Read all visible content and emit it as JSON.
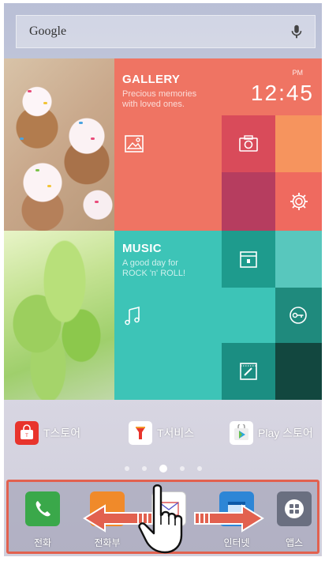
{
  "search": {
    "label": "Google",
    "mic_icon": "mic-icon"
  },
  "tiles": {
    "gallery": {
      "title": "GALLERY",
      "subtitle_line1": "Precious memories",
      "subtitle_line2": "with loved ones.",
      "icon": "image-icon"
    },
    "clock": {
      "ampm": "PM",
      "time": "12:45"
    },
    "camera": {
      "icon": "camera-icon"
    },
    "settings": {
      "icon": "gear-icon"
    },
    "music": {
      "title": "MUSIC",
      "subtitle_line1": "A good day for",
      "subtitle_line2": "ROCK 'n' ROLL!",
      "icon": "music-note-icon"
    },
    "calendar": {
      "icon": "calendar-icon"
    },
    "key": {
      "icon": "key-icon"
    },
    "notes": {
      "icon": "pencil-note-icon"
    }
  },
  "shortcuts": [
    {
      "label": "T스토어",
      "icon": "tstore-icon",
      "color": "#e8342c"
    },
    {
      "label": "T서비스",
      "icon": "tservice-icon",
      "color": "#ffffff"
    },
    {
      "label": "Play 스토어",
      "icon": "play-store-icon",
      "color": "#ffffff"
    }
  ],
  "pages": {
    "count": 5,
    "active": 3
  },
  "dock": [
    {
      "label": "전화",
      "icon": "phone-icon",
      "color": "#3aa84a"
    },
    {
      "label": "전화부",
      "icon": "contacts-icon",
      "color": "#f08a2a"
    },
    {
      "label": "",
      "icon": "message-icon",
      "color": "#ffffff"
    },
    {
      "label": "인터넷",
      "icon": "internet-icon",
      "color": "#2d86d6"
    },
    {
      "label": "앱스",
      "icon": "apps-icon",
      "color": "#6a6f80"
    }
  ],
  "gesture": {
    "left_arrow": "arrow-left-icon",
    "right_arrow": "arrow-right-icon",
    "hand": "pointing-hand-icon",
    "arrow_color": "#e2614f"
  },
  "accent": "#e2614f"
}
